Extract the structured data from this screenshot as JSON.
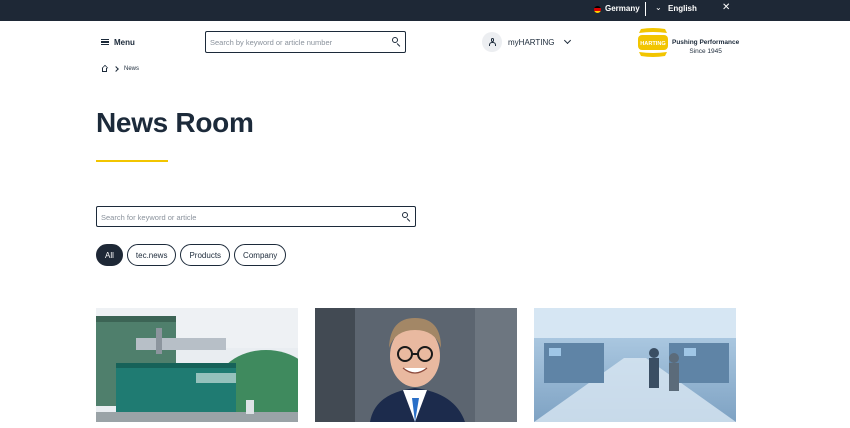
{
  "topbar": {
    "country": "Germany",
    "language": "English",
    "flag_colors": [
      "#000000",
      "#dd0000",
      "#ffce00"
    ]
  },
  "header": {
    "menu_label": "Menu",
    "search_placeholder": "Search by keyword or article number",
    "account_label": "myHARTING",
    "logo_text": "HARTING",
    "slogan_line1": "Pushing Performance",
    "slogan_line2": "Since 1945"
  },
  "breadcrumb": {
    "current": "News"
  },
  "main": {
    "title": "News Room",
    "search_placeholder": "Search for keyword or article",
    "filters": [
      {
        "label": "All",
        "active": true
      },
      {
        "label": "tec.news",
        "active": false
      },
      {
        "label": "Products",
        "active": false
      },
      {
        "label": "Company",
        "active": false
      }
    ]
  },
  "colors": {
    "dark": "#1e2836",
    "accent": "#f2c500"
  },
  "cards": [
    {
      "image": "biogas-plant-photo"
    },
    {
      "image": "portrait-photo"
    },
    {
      "image": "factory-hall-photo"
    }
  ]
}
